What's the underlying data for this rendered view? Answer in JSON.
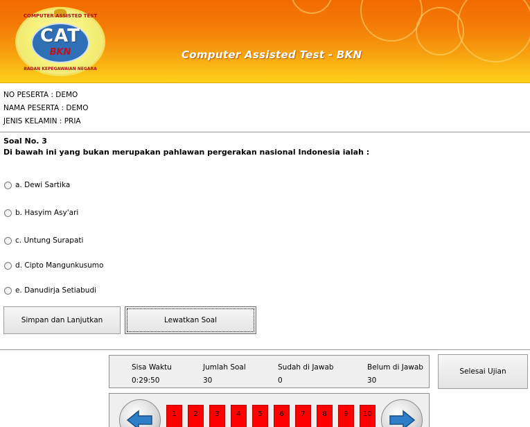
{
  "header": {
    "logo": {
      "main": "CAT",
      "sub": "BKN",
      "arc_top": "COMPUTER ASSISTED TEST",
      "arc_bottom": "BADAN KEPEGAWAIAN NEGARA"
    },
    "title": "Computer Assisted Test - BKN"
  },
  "participant": {
    "no_peserta": "NO PESERTA :  DEMO",
    "nama_peserta": "NAMA PESERTA : DEMO",
    "jenis_kelamin": "JENIS KELAMIN : PRIA"
  },
  "question": {
    "number": "Soal No. 3",
    "text": "Di bawah ini yang bukan merupakan pahlawan pergerakan nasional Indonesia ialah :",
    "options": [
      "a. Dewi Sartika",
      "b. Hasyim Asy'ari",
      "c. Untung Surapati",
      "d. Cipto Mangunkusumo",
      "e. Danudirja Setiabudi"
    ],
    "selected": null
  },
  "actions": {
    "save_next": "Simpan dan Lanjutkan",
    "skip": "Lewatkan Soal",
    "finish": "Selesai Ujian"
  },
  "status": {
    "time_label": "Sisa Waktu",
    "time_value": "0:29:50",
    "total_label": "Jumlah Soal",
    "total_value": "30",
    "answered_label": "Sudah di Jawab",
    "answered_value": "0",
    "unanswered_label": "Belum di Jawab",
    "unanswered_value": "30"
  },
  "navigation": {
    "question_numbers": [
      "1",
      "2",
      "3",
      "4",
      "5",
      "6",
      "7",
      "8",
      "9",
      "10"
    ],
    "unanswered_color": "#ff0000"
  },
  "colors": {
    "header_top": "#f26a00",
    "header_bottom": "#fdd21a",
    "logo_blue": "#2f6fb6"
  }
}
